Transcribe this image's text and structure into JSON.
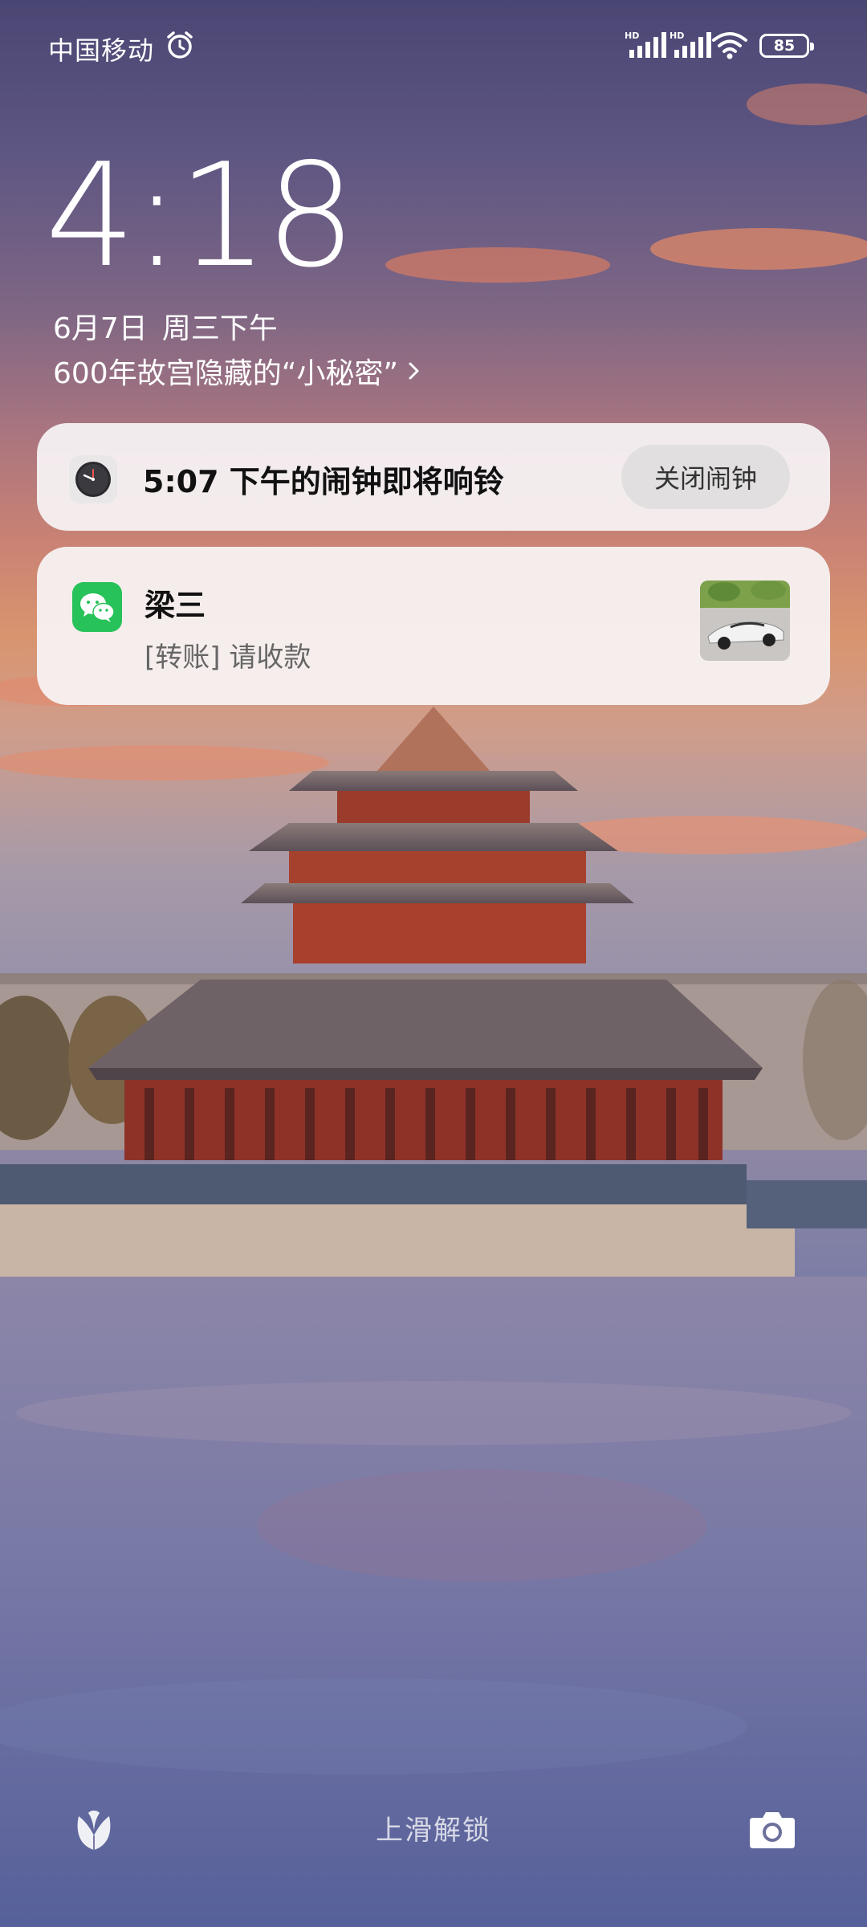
{
  "status_bar": {
    "carrier": "中国移动",
    "signal_1_label": "HD",
    "signal_2_label": "HD",
    "battery_level": "85"
  },
  "lock_screen": {
    "time": "4:18",
    "date": "6月7日",
    "weekday_period": "周三下午",
    "story_link": "600年故宫隐藏的“小秘密”"
  },
  "notifications": {
    "alarm": {
      "app_icon": "clock-icon",
      "text": "5:07 下午的闹钟即将响铃",
      "action_label": "关闭闹钟"
    },
    "wechat": {
      "app_icon": "wechat-icon",
      "sender": "梁三",
      "message": "[转账] 请收款"
    }
  },
  "bottom": {
    "unlock_hint": "上滑解锁"
  },
  "colors": {
    "wechat_green": "#27c25a",
    "card_bg": "#f7f4f5"
  }
}
